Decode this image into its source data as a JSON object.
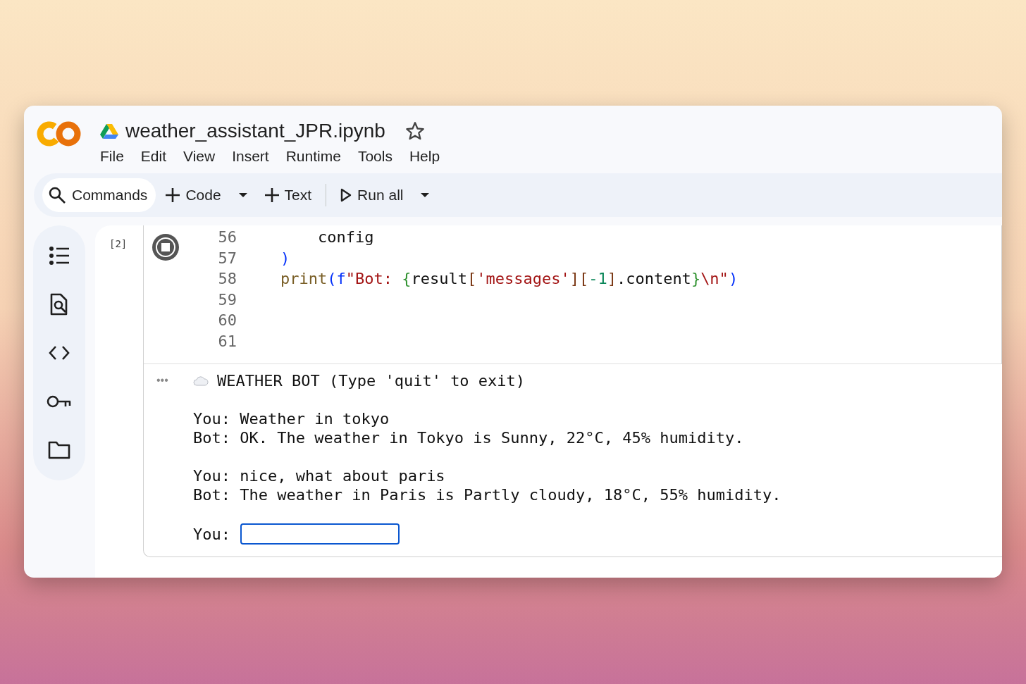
{
  "notebook": {
    "title": "weather_assistant_JPR.ipynb",
    "starred": false
  },
  "menu": [
    "File",
    "Edit",
    "View",
    "Insert",
    "Runtime",
    "Tools",
    "Help"
  ],
  "toolbar": {
    "commands": "Commands",
    "buttons": [
      {
        "kind": "add",
        "label": "Code",
        "dropdown": true
      },
      {
        "kind": "add",
        "label": "Text",
        "dropdown": false
      },
      {
        "kind": "run",
        "label": "Run all",
        "dropdown": true
      }
    ]
  },
  "sidebar": {
    "items": [
      {
        "kind": "toc"
      },
      {
        "kind": "find"
      },
      {
        "kind": "snippets"
      },
      {
        "kind": "secrets"
      },
      {
        "kind": "files"
      }
    ]
  },
  "cell": {
    "execution_count": "[2]",
    "running": true,
    "lines": [
      {
        "number": "56",
        "tokens": [
          {
            "text": "    config",
            "kind": "name"
          }
        ]
      },
      {
        "number": "57",
        "tokens": [
          {
            "text": ")",
            "kind": "paren"
          }
        ]
      },
      {
        "number": "58",
        "tokens": [
          {
            "text": "print",
            "kind": "function"
          },
          {
            "text": "(",
            "kind": "paren"
          },
          {
            "text": "f",
            "kind": "paren"
          },
          {
            "text": "\"Bot: ",
            "kind": "string"
          },
          {
            "text": "{",
            "kind": "brace"
          },
          {
            "text": "result",
            "kind": "name"
          },
          {
            "text": "[",
            "kind": "bracket"
          },
          {
            "text": "'messages'",
            "kind": "string"
          },
          {
            "text": "]",
            "kind": "bracket"
          },
          {
            "text": "[",
            "kind": "bracket"
          },
          {
            "text": "-1",
            "kind": "number"
          },
          {
            "text": "]",
            "kind": "bracket"
          },
          {
            "text": ".content",
            "kind": "name"
          },
          {
            "text": "}",
            "kind": "brace"
          },
          {
            "text": "\\n\"",
            "kind": "string"
          },
          {
            "text": ")",
            "kind": "paren"
          }
        ]
      },
      {
        "number": "59"
      },
      {
        "number": "60"
      },
      {
        "number": "61"
      }
    ],
    "output": {
      "more": "•••",
      "header": "WEATHER BOT (Type 'quit' to exit)",
      "blocks": [
        [
          "You: Weather in tokyo",
          "Bot: OK. The weather in Tokyo is Sunny, 22°C, 45% humidity."
        ],
        [
          "You: nice, what about paris",
          "Bot: The weather in Paris is Partly cloudy, 18°C, 55% humidity."
        ]
      ],
      "prompt": "You:",
      "input": {
        "focused": true
      }
    }
  }
}
